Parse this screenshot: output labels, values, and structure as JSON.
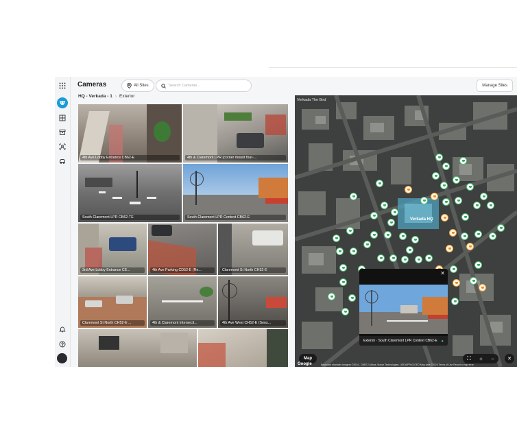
{
  "header": {
    "title": "Cameras",
    "sites_button": "All Sites",
    "search_placeholder": "Search Cameras...",
    "manage_button": "Manage Sites"
  },
  "breadcrumb": {
    "site": "HQ - Verkada - 1",
    "separator": "›",
    "group": "Exterior"
  },
  "cameras": [
    {
      "label": "4th Ave Lobby Entrance CB62-E"
    },
    {
      "label": "4th & Claremont LPR (corner mount four-..."
    },
    {
      "label": "South Claremont LPR CB62-TE"
    },
    {
      "label": "South Claremont LPR Context CB62-E"
    },
    {
      "label": "3rd Ave Lobby Entrance CE..."
    },
    {
      "label": "4th Ave Parking CD52-E (Re..."
    },
    {
      "label": "Claremont St North CH52-E"
    },
    {
      "label": "Claremont St North CH52-E ..."
    },
    {
      "label": "4th & Claremont Intersecti..."
    },
    {
      "label": "4th Ave West CH52-E (Sens..."
    },
    {
      "label": ""
    },
    {
      "label": ""
    }
  ],
  "map": {
    "street_label": "Verkada The Bird",
    "hq_label": "Verkada HQ",
    "popup_caption": "Exterior · South Claremont LPR Context CB62-E",
    "map_button": "Map",
    "google": "Google",
    "attribution": "Keyboard shortcuts   Imagery ©2024 , CNES / Airbus, Maxar Technologies, USDA/FPAC/GEO   Map data ©2024   Terms of Use   Report a map error"
  },
  "icons": {
    "rail": [
      "apps-grid-icon",
      "camera-dome-icon",
      "layout-grid-icon",
      "archive-icon",
      "people-icon",
      "car-icon",
      "bell-icon",
      "help-icon"
    ]
  },
  "colors": {
    "accent": "#1a9bd7",
    "pin_green": "#55c07e",
    "pin_orange": "#f0a640"
  }
}
